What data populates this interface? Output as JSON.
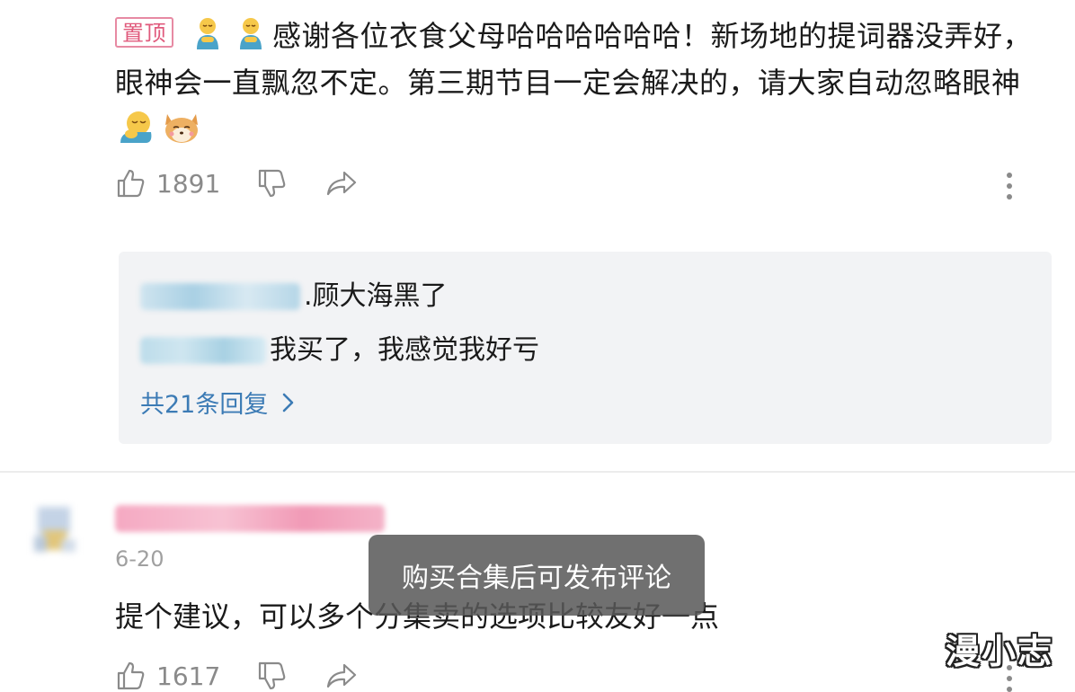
{
  "pinned_comment": {
    "badge": "置顶",
    "text_part1": "感谢各位衣食父母哈哈哈哈哈哈！新场地的提词器没弄好，眼神会一直飘忽不定。第三期节目一定会解决的，请大家自动忽略眼神",
    "likes": "1891",
    "emojis": [
      "bowing-emoji",
      "bowing-emoji",
      "hugging-emoji",
      "shiba-dog-emoji"
    ]
  },
  "replies": {
    "items": [
      {
        "name_suffix": ".",
        "text": " 顾大海黑了"
      },
      {
        "name_suffix": "",
        "text": "我买了，我感觉我好亏"
      }
    ],
    "more_label": "共21条回复"
  },
  "second_comment": {
    "date": "6-20",
    "text": "提个建议，可以多个分集卖的选项比较友好一点",
    "likes": "1617"
  },
  "toast": {
    "message": "购买合集后可发布评论"
  },
  "watermark": "漫小志",
  "colors": {
    "badge": "#e05a7c",
    "link": "#3c7bb5",
    "muted": "#8a8a8a",
    "reply_bg": "#f2f3f5"
  }
}
